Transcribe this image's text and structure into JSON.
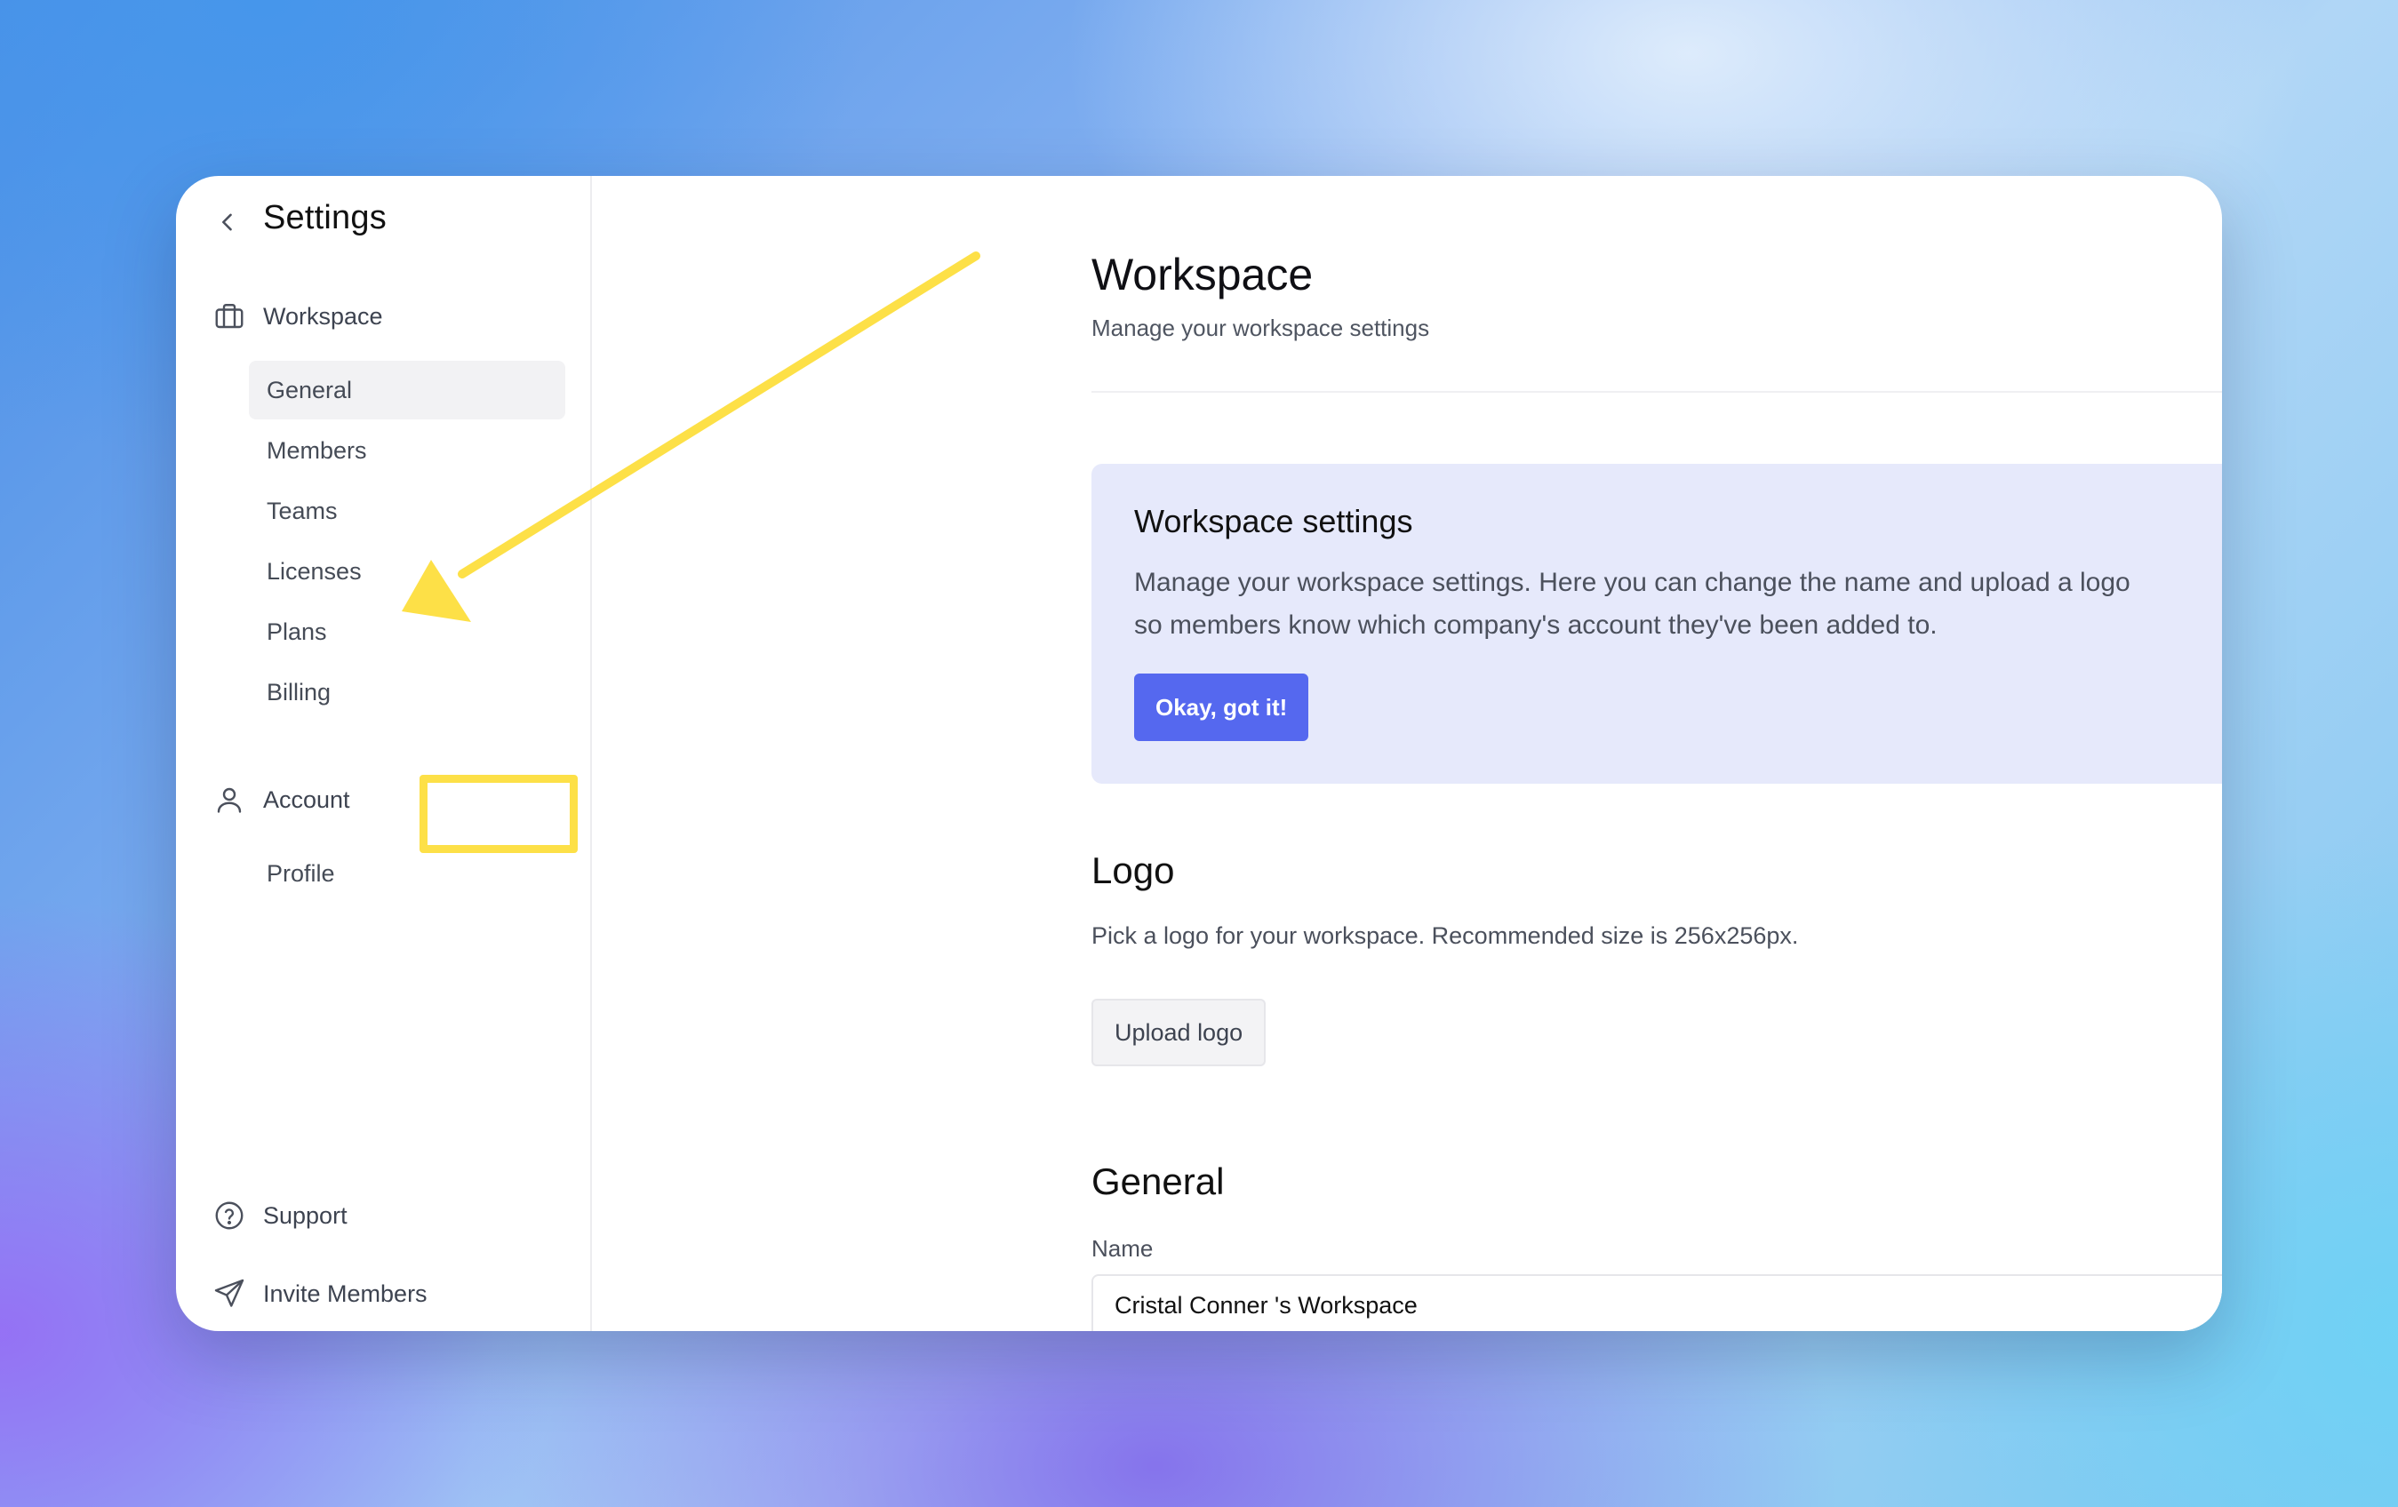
{
  "sidebar": {
    "title": "Settings",
    "workspace_section": {
      "label": "Workspace",
      "items": [
        {
          "label": "General"
        },
        {
          "label": "Members"
        },
        {
          "label": "Teams"
        },
        {
          "label": "Licenses"
        },
        {
          "label": "Plans"
        },
        {
          "label": "Billing"
        }
      ]
    },
    "account_section": {
      "label": "Account",
      "items": [
        {
          "label": "Profile"
        }
      ]
    },
    "support_label": "Support",
    "invite_label": "Invite Members"
  },
  "main": {
    "title": "Workspace",
    "subtitle": "Manage your workspace settings",
    "callout": {
      "title": "Workspace settings",
      "body": "Manage your workspace settings. Here you can change the name and upload a logo so members know which company's account they've been added to.",
      "button_label": "Okay, got it!"
    },
    "logo": {
      "title": "Logo",
      "description": "Pick a logo for your workspace. Recommended size is 256x256px.",
      "button_label": "Upload logo"
    },
    "general": {
      "title": "General",
      "name_label": "Name",
      "name_value": "Cristal Conner 's Workspace"
    }
  },
  "colors": {
    "accent": "#5568ef",
    "callout_bg": "#e6e9fb",
    "annotation": "#fde047",
    "active_nav_bg": "#f2f2f4"
  },
  "icons": {
    "back": "chevron-left-icon",
    "workspace": "briefcase-icon",
    "account": "user-icon",
    "support": "help-circle-icon",
    "invite": "send-icon"
  }
}
